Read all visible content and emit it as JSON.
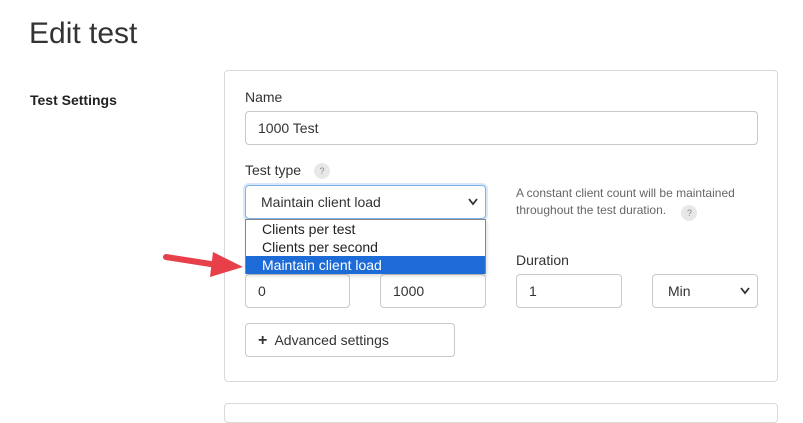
{
  "page": {
    "title": "Edit test"
  },
  "section": {
    "label": "Test Settings"
  },
  "form": {
    "name_label": "Name",
    "name_value": "1000 Test",
    "test_type_label": "Test type",
    "help_glyph": "?",
    "test_type_selected": "Maintain client load",
    "test_type_hint": "A constant client count will be maintained throughout the test duration.",
    "test_type_options": [
      "Clients per test",
      "Clients per second",
      "Maintain client load"
    ],
    "duration_label": "Duration",
    "field1_value": "0",
    "field2_value": "1000",
    "duration_value": "1",
    "duration_unit": "Min",
    "advanced_label": "Advanced settings",
    "plus_glyph": "+"
  },
  "colors": {
    "accent": "#1d6bd6",
    "arrow": "#e8404a"
  },
  "icons": {
    "dropdown": "chevron-down-icon",
    "help": "question-icon",
    "annotation": "red-arrow-icon"
  }
}
